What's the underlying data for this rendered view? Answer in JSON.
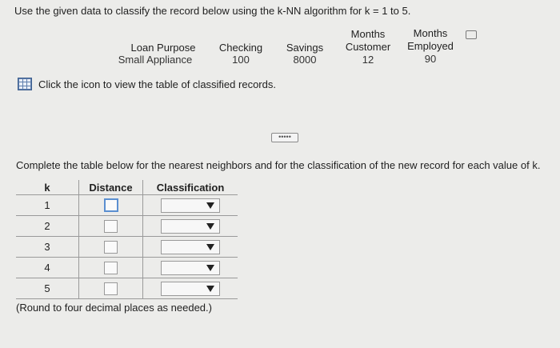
{
  "prompt": "Use the given data to classify the record below using the k-NN algorithm for k = 1 to 5.",
  "record": {
    "headers": {
      "loan_purpose": "Loan Purpose",
      "checking": "Checking",
      "savings": "Savings",
      "months_customer_1": "Months",
      "months_customer_2": "Customer",
      "months_employed_1": "Months",
      "months_employed_2": "Employed"
    },
    "values": {
      "loan_purpose": "Small Appliance",
      "checking": "100",
      "savings": "8000",
      "months_customer": "12",
      "months_employed": "90"
    }
  },
  "click_text": "Click the icon to view the table of classified records.",
  "ellipsis": "•••••",
  "complete_text": "Complete the table below for the nearest neighbors and for the classification of the new record for each value of k.",
  "table": {
    "headers": {
      "k": "k",
      "distance": "Distance",
      "classification": "Classification"
    },
    "rows": [
      {
        "k": "1"
      },
      {
        "k": "2"
      },
      {
        "k": "3"
      },
      {
        "k": "4"
      },
      {
        "k": "5"
      }
    ]
  },
  "round_note": "(Round to four decimal places as needed.)",
  "icons": {
    "table_icon": "table-grid-icon",
    "print": "print-icon",
    "dropdown": "triangle-down-icon"
  },
  "colors": {
    "accent": "#5b8fd0",
    "icon_blue": "#5f7fae"
  }
}
